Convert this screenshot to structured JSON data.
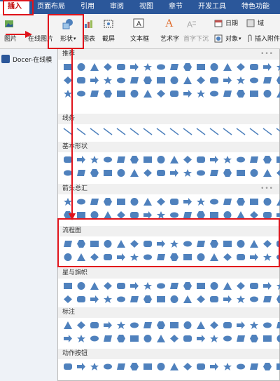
{
  "menu": {
    "items": [
      "插入",
      "页面布局",
      "引用",
      "审阅",
      "视图",
      "章节",
      "开发工具",
      "特色功能"
    ],
    "active_index": 0
  },
  "ribbon": {
    "picture": "图片",
    "online_picture": "在线图片",
    "shapes": "形状",
    "chart": "图表",
    "screenshot": "截屏",
    "textbox": "文本框",
    "wordart": "艺术字",
    "dropcap": "首字下沉",
    "date": "日期",
    "field": "域",
    "object": "对象",
    "attachment": "插入附件"
  },
  "doc_tab": "Docer-在线模",
  "sections": [
    {
      "label": "推荐"
    },
    {
      "label": "线条"
    },
    {
      "label": "基本形状"
    },
    {
      "label": "箭头总汇"
    },
    {
      "label": "流程图"
    },
    {
      "label": "星与旗帜"
    },
    {
      "label": "标注"
    },
    {
      "label": "动作按钮"
    }
  ],
  "colors": {
    "menubar": "#2b579a",
    "shape_fill": "#4f81bd",
    "annotation": "#e0131b"
  }
}
